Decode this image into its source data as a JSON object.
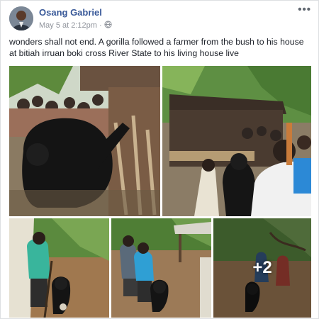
{
  "post": {
    "author": "Osang Gabriel",
    "timestamp": "May 5 at 2:12pm",
    "privacy_icon": "globe-icon",
    "more_label": "•••",
    "text": "wonders shall not end. A gorilla followed a farmer from the bush to his house at bitiah irruan boki cross River State to his living house live"
  },
  "photos": {
    "count_overlay": "+2"
  },
  "colors": {
    "name_link": "#385898",
    "meta": "#90949c",
    "foliage": "#3f7a2e",
    "gorilla": "#1b1b1b"
  }
}
